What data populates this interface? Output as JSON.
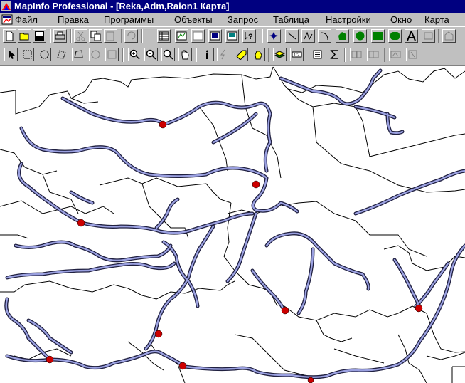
{
  "window": {
    "title": "MapInfo Professional - [Reka,Adm,Raion1 Карта]"
  },
  "menu": [
    {
      "label": "Файл"
    },
    {
      "label": "Правка"
    },
    {
      "label": "Программы"
    },
    {
      "label": "Объекты"
    },
    {
      "label": "Запрос"
    },
    {
      "label": "Таблица"
    },
    {
      "label": "Настройки"
    },
    {
      "label": "Окно"
    },
    {
      "label": "Карта"
    }
  ],
  "toolbar_main": [
    {
      "icon": "new-file-icon"
    },
    {
      "icon": "open-folder-icon"
    },
    {
      "icon": "save-icon"
    },
    {
      "icon": "print-icon"
    },
    {
      "icon": "cut-icon"
    },
    {
      "icon": "copy-icon"
    },
    {
      "icon": "paste-icon"
    },
    {
      "icon": "undo-icon"
    },
    {
      "icon": "new-browser-icon"
    },
    {
      "icon": "new-mapper-icon"
    },
    {
      "icon": "new-grapher-icon"
    },
    {
      "icon": "new-layout-icon"
    },
    {
      "icon": "redistrict-icon"
    },
    {
      "icon": "help-icon"
    },
    {
      "icon": "symbol-tool-icon"
    },
    {
      "icon": "line-tool-icon"
    },
    {
      "icon": "polyline-tool-icon"
    },
    {
      "icon": "arc-tool-icon"
    },
    {
      "icon": "polygon-tool-icon"
    },
    {
      "icon": "ellipse-tool-icon"
    },
    {
      "icon": "rectangle-tool-icon"
    },
    {
      "icon": "rounded-rectangle-tool-icon"
    },
    {
      "icon": "text-tool-icon"
    },
    {
      "icon": "frame-tool-icon"
    },
    {
      "icon": "reshape-tool-icon"
    }
  ],
  "toolbar_tools": [
    {
      "icon": "select-arrow-icon"
    },
    {
      "icon": "marquee-select-icon"
    },
    {
      "icon": "radius-select-icon"
    },
    {
      "icon": "polygon-select-icon"
    },
    {
      "icon": "boundary-select-icon"
    },
    {
      "icon": "unselect-icon"
    },
    {
      "icon": "graph-select-icon"
    },
    {
      "icon": "zoom-in-icon"
    },
    {
      "icon": "zoom-out-icon"
    },
    {
      "icon": "change-view-icon"
    },
    {
      "icon": "grabber-hand-icon"
    },
    {
      "icon": "info-tool-icon"
    },
    {
      "icon": "hotlink-icon"
    },
    {
      "icon": "label-tool-icon"
    },
    {
      "icon": "drag-map-icon"
    },
    {
      "icon": "layer-control-icon"
    },
    {
      "icon": "ruler-icon"
    },
    {
      "icon": "legend-icon"
    },
    {
      "icon": "statistics-icon"
    },
    {
      "icon": "setup-map-icon"
    },
    {
      "icon": "clip-region-icon"
    },
    {
      "icon": "show-hide-legend-icon"
    },
    {
      "icon": "show-hide-statistics-icon"
    }
  ],
  "colors": {
    "titlebar": "#000080",
    "chrome": "#c0c0c0",
    "river": "#7b84c8",
    "point": "#cc0000"
  }
}
